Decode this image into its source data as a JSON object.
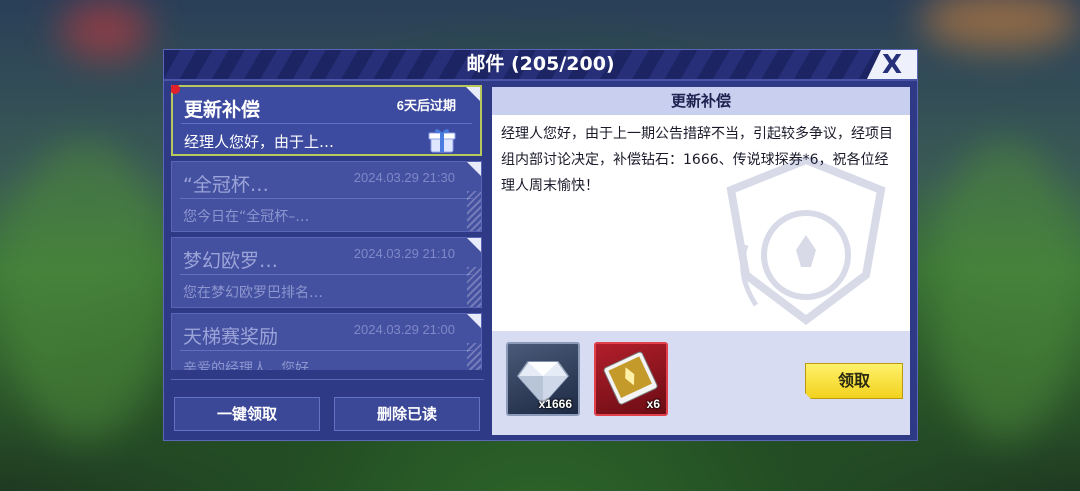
{
  "dialog": {
    "title": "邮件 (205/200)",
    "close_label": "X"
  },
  "mail_list": [
    {
      "subject": "更新补偿",
      "date": "6天后过期",
      "preview": "经理人您好，由于上…",
      "unread": true,
      "active": true
    },
    {
      "subject": "“全冠杯…",
      "date": "2024.03.29 21:30",
      "preview": "您今日在“全冠杯–…"
    },
    {
      "subject": "梦幻欧罗…",
      "date": "2024.03.29 21:10",
      "preview": "您在梦幻欧罗巴排名…"
    },
    {
      "subject": "天梯赛奖励",
      "date": "2024.03.29 21:00",
      "preview": "亲爱的经理人，您好"
    }
  ],
  "buttons": {
    "claim_all": "一键领取",
    "delete_read": "删除已读",
    "claim": "领取"
  },
  "detail": {
    "header": "更新补偿",
    "body": "经理人您好，由于上一期公告措辞不当，引起较多争议，经项目组内部讨论决定，补偿钻石：1666、传说球探券*6，祝各位经理人周末愉快！"
  },
  "attachments": [
    {
      "icon": "diamond-icon",
      "quantity": "x1666"
    },
    {
      "icon": "legend-scout-ticket-icon",
      "quantity": "x6"
    }
  ],
  "colors": {
    "panel": "#2e3a86",
    "claim_button": "#f2d21e",
    "unread_dot": "#e0202a"
  }
}
